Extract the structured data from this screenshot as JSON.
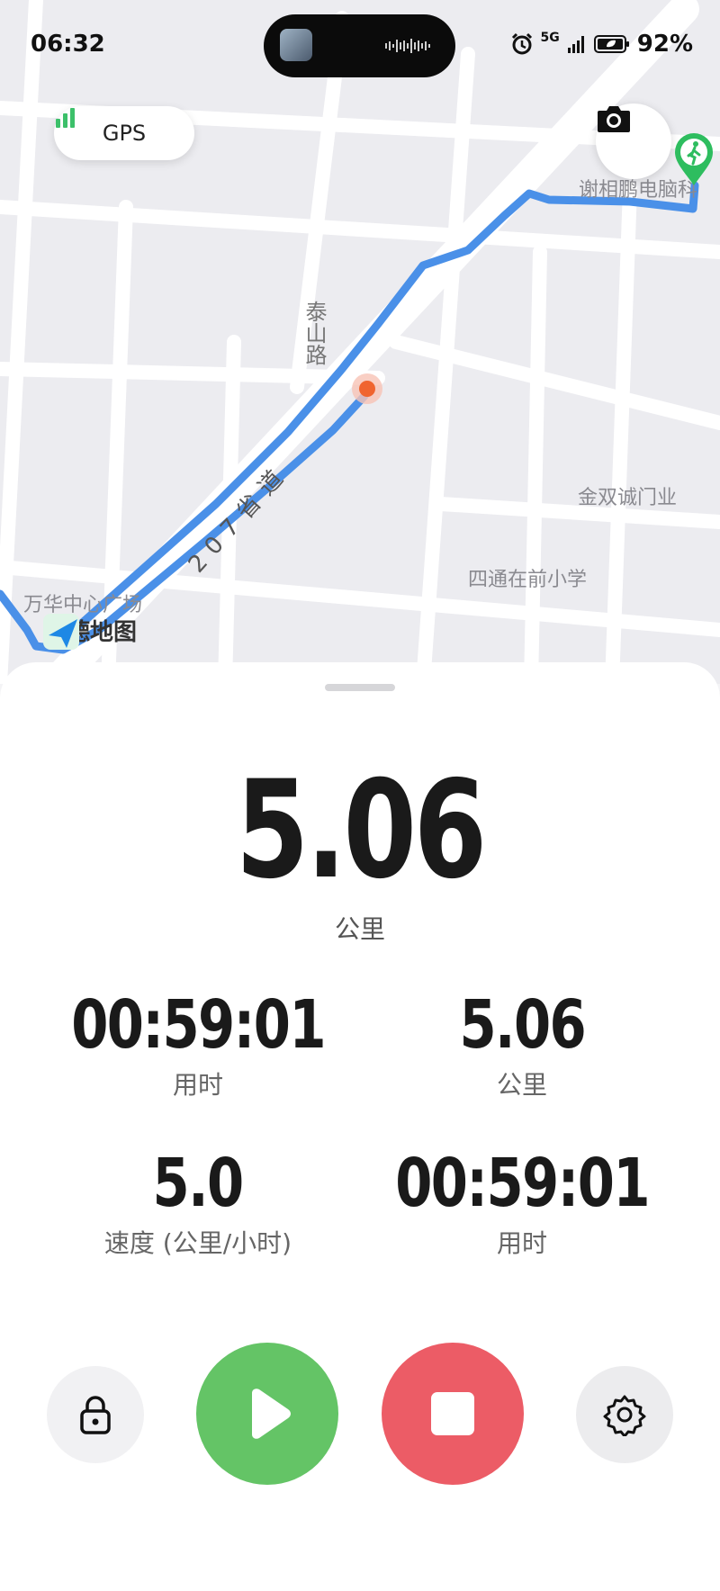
{
  "status_bar": {
    "time": "06:32",
    "network": "5G",
    "battery": "92%"
  },
  "gps": {
    "label": "GPS"
  },
  "map": {
    "labels": {
      "road_taishan": "泰山路",
      "road_207": "207省道",
      "poi_xie": "谢相鹏电脑科",
      "poi_jinshuang": "金双诚门业",
      "poi_sitong": "四通在前小学",
      "poi_wanhua": "万华中心广场"
    },
    "brand": "高德地图",
    "route_color": "#4a90e8"
  },
  "workout": {
    "distance": "5.06",
    "distance_unit": "公里",
    "stats": [
      {
        "value": "00:59:01",
        "label": "用时"
      },
      {
        "value": "5.06",
        "label": "公里"
      },
      {
        "value": "5.0",
        "label": "速度 (公里/小时)"
      },
      {
        "value": "00:59:01",
        "label": "用时"
      }
    ]
  },
  "controls": {
    "lock_icon": "lock-icon",
    "play_icon": "play-icon",
    "stop_icon": "stop-icon",
    "settings_icon": "gear-icon",
    "play_color": "#64c466",
    "stop_color": "#ec5c66"
  }
}
